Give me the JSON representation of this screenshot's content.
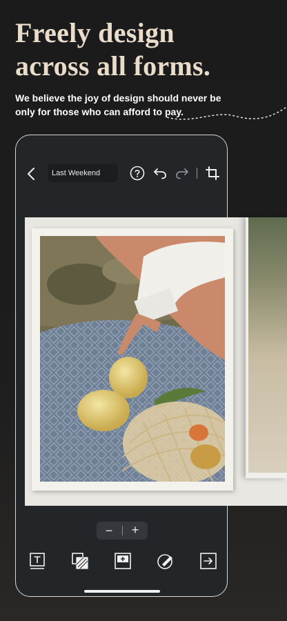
{
  "headline": {
    "line1": "Freely design",
    "line2": "across all forms."
  },
  "subline": "We believe the joy of design should never be only for those who can afford to pay.",
  "editor": {
    "title": "Last Weekend",
    "zoom": {
      "minus": "−",
      "plus": "+"
    }
  },
  "icons": {
    "back": "chevron-left-icon",
    "help": "question-circle-icon",
    "undo": "undo-icon",
    "redo": "redo-icon",
    "crop": "crop-icon",
    "tools": [
      "text-tool-icon",
      "layers-tool-icon",
      "add-frame-icon",
      "edit-style-icon",
      "export-icon"
    ]
  },
  "colors": {
    "background": "#1b1b1b",
    "headline": "#eadccb",
    "phone_bg": "#232629",
    "phone_border": "#d9d9d9"
  }
}
